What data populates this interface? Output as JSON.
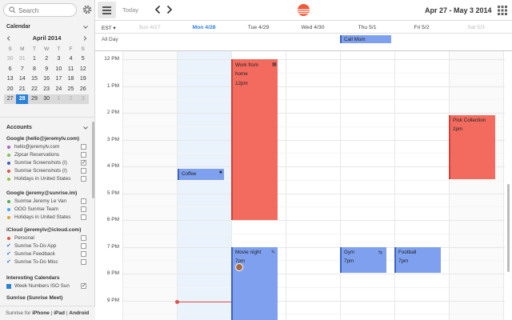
{
  "sidebar": {
    "search_placeholder": "Search",
    "calendar_header": "Calendar",
    "mini_month": "April 2014",
    "dow": [
      "S",
      "M",
      "T",
      "W",
      "T",
      "F",
      "S"
    ],
    "weeks": [
      [
        "30",
        "31",
        "1",
        "2",
        "3",
        "4",
        "5"
      ],
      [
        "6",
        "7",
        "8",
        "9",
        "10",
        "11",
        "12"
      ],
      [
        "13",
        "14",
        "15",
        "16",
        "17",
        "18",
        "19"
      ],
      [
        "20",
        "21",
        "22",
        "23",
        "24",
        "25",
        "26"
      ],
      [
        "27",
        "28",
        "29",
        "30",
        "1",
        "2",
        "3"
      ]
    ],
    "accounts_header": "Accounts",
    "groups": [
      {
        "name": "Google (hello@jeremylv.com)",
        "items": [
          {
            "label": "hello@jeremylv.com",
            "color": "#b05fd6",
            "checked": false
          },
          {
            "label": "Zipcar Reservations",
            "color": "#7ec24f",
            "checked": false
          },
          {
            "label": "Sunrise Screenshots (I)",
            "color": "#3a60c9",
            "checked": true
          },
          {
            "label": "Sunrise Screenshots (I)",
            "color": "#e2513f",
            "checked": false
          },
          {
            "label": "Holidays in United States",
            "color": "#8bc34a",
            "checked": false
          }
        ]
      },
      {
        "name": "Google (jeremy@sunrise.im)",
        "items": [
          {
            "label": "Sunrise Jeremy Le Van",
            "color": "#4caf50",
            "checked": false
          },
          {
            "label": "OOO Sunrise Team",
            "color": "#42a5f5",
            "checked": false
          },
          {
            "label": "Holidays in United States",
            "color": "#e0a030",
            "checked": false
          }
        ]
      },
      {
        "name": "iCloud (jeremylv@icloud.com)",
        "items": [
          {
            "label": "Personal",
            "color": "#e2513f",
            "checked": false,
            "marker": "dot"
          },
          {
            "label": "Sunrise To-Do App",
            "color": "#2b82d9",
            "checked": false,
            "marker": "check"
          },
          {
            "label": "Sunrise Feedback",
            "color": "#2b82d9",
            "checked": false,
            "marker": "check"
          },
          {
            "label": "Sunrise To-Do Misc",
            "color": "#2b82d9",
            "checked": false,
            "marker": "check"
          }
        ]
      },
      {
        "name": "Interesting Calendars",
        "items": [
          {
            "label": "Week Numbers ISO Sun",
            "color": "#2b82d9",
            "checked": true,
            "marker": "square"
          }
        ]
      }
    ],
    "more_header": "Sunrise (Sunrise Meet)",
    "footer": {
      "prefix": "Sunrise for ",
      "iphone": "iPhone",
      "sep1": " | ",
      "ipad": "iPad",
      "sep2": " | ",
      "android": "Android"
    }
  },
  "toolbar": {
    "today_label": "Today",
    "date_range": "Apr 27 - May 3 2014",
    "brand_colors": {
      "sun": "#f05a3c",
      "sun_dark": "#c93a2a"
    }
  },
  "week": {
    "timezone": "EST",
    "all_day_label": "All Day",
    "days": [
      {
        "label": "Sun 4/27",
        "kind": "weekend"
      },
      {
        "label": "Mon 4/28",
        "kind": "today"
      },
      {
        "label": "Tue 4/29",
        "kind": "weekday"
      },
      {
        "label": "Wed 4/30",
        "kind": "weekday"
      },
      {
        "label": "Thu 5/1",
        "kind": "weekday"
      },
      {
        "label": "Fri 5/2",
        "kind": "weekday"
      },
      {
        "label": "Sat 5/3",
        "kind": "weekend"
      }
    ],
    "hours": [
      "12 PM",
      "1 PM",
      "2 PM",
      "3 PM",
      "4 PM",
      "5 PM",
      "6 PM",
      "7 PM",
      "8 PM",
      "9 PM"
    ]
  },
  "events": {
    "call_mom": {
      "title": "Call Mom"
    },
    "work_from_home": {
      "title": "Work from home",
      "time": "12pm"
    },
    "coffee": {
      "title": "Coffee"
    },
    "pick_collection": {
      "title": "Pick Collection",
      "time": "2pm"
    },
    "movie_night": {
      "title": "Movie night",
      "time": "7pm"
    },
    "gym": {
      "title": "Gym",
      "time": "7pm"
    },
    "football": {
      "title": "Football",
      "time": "7pm"
    }
  }
}
